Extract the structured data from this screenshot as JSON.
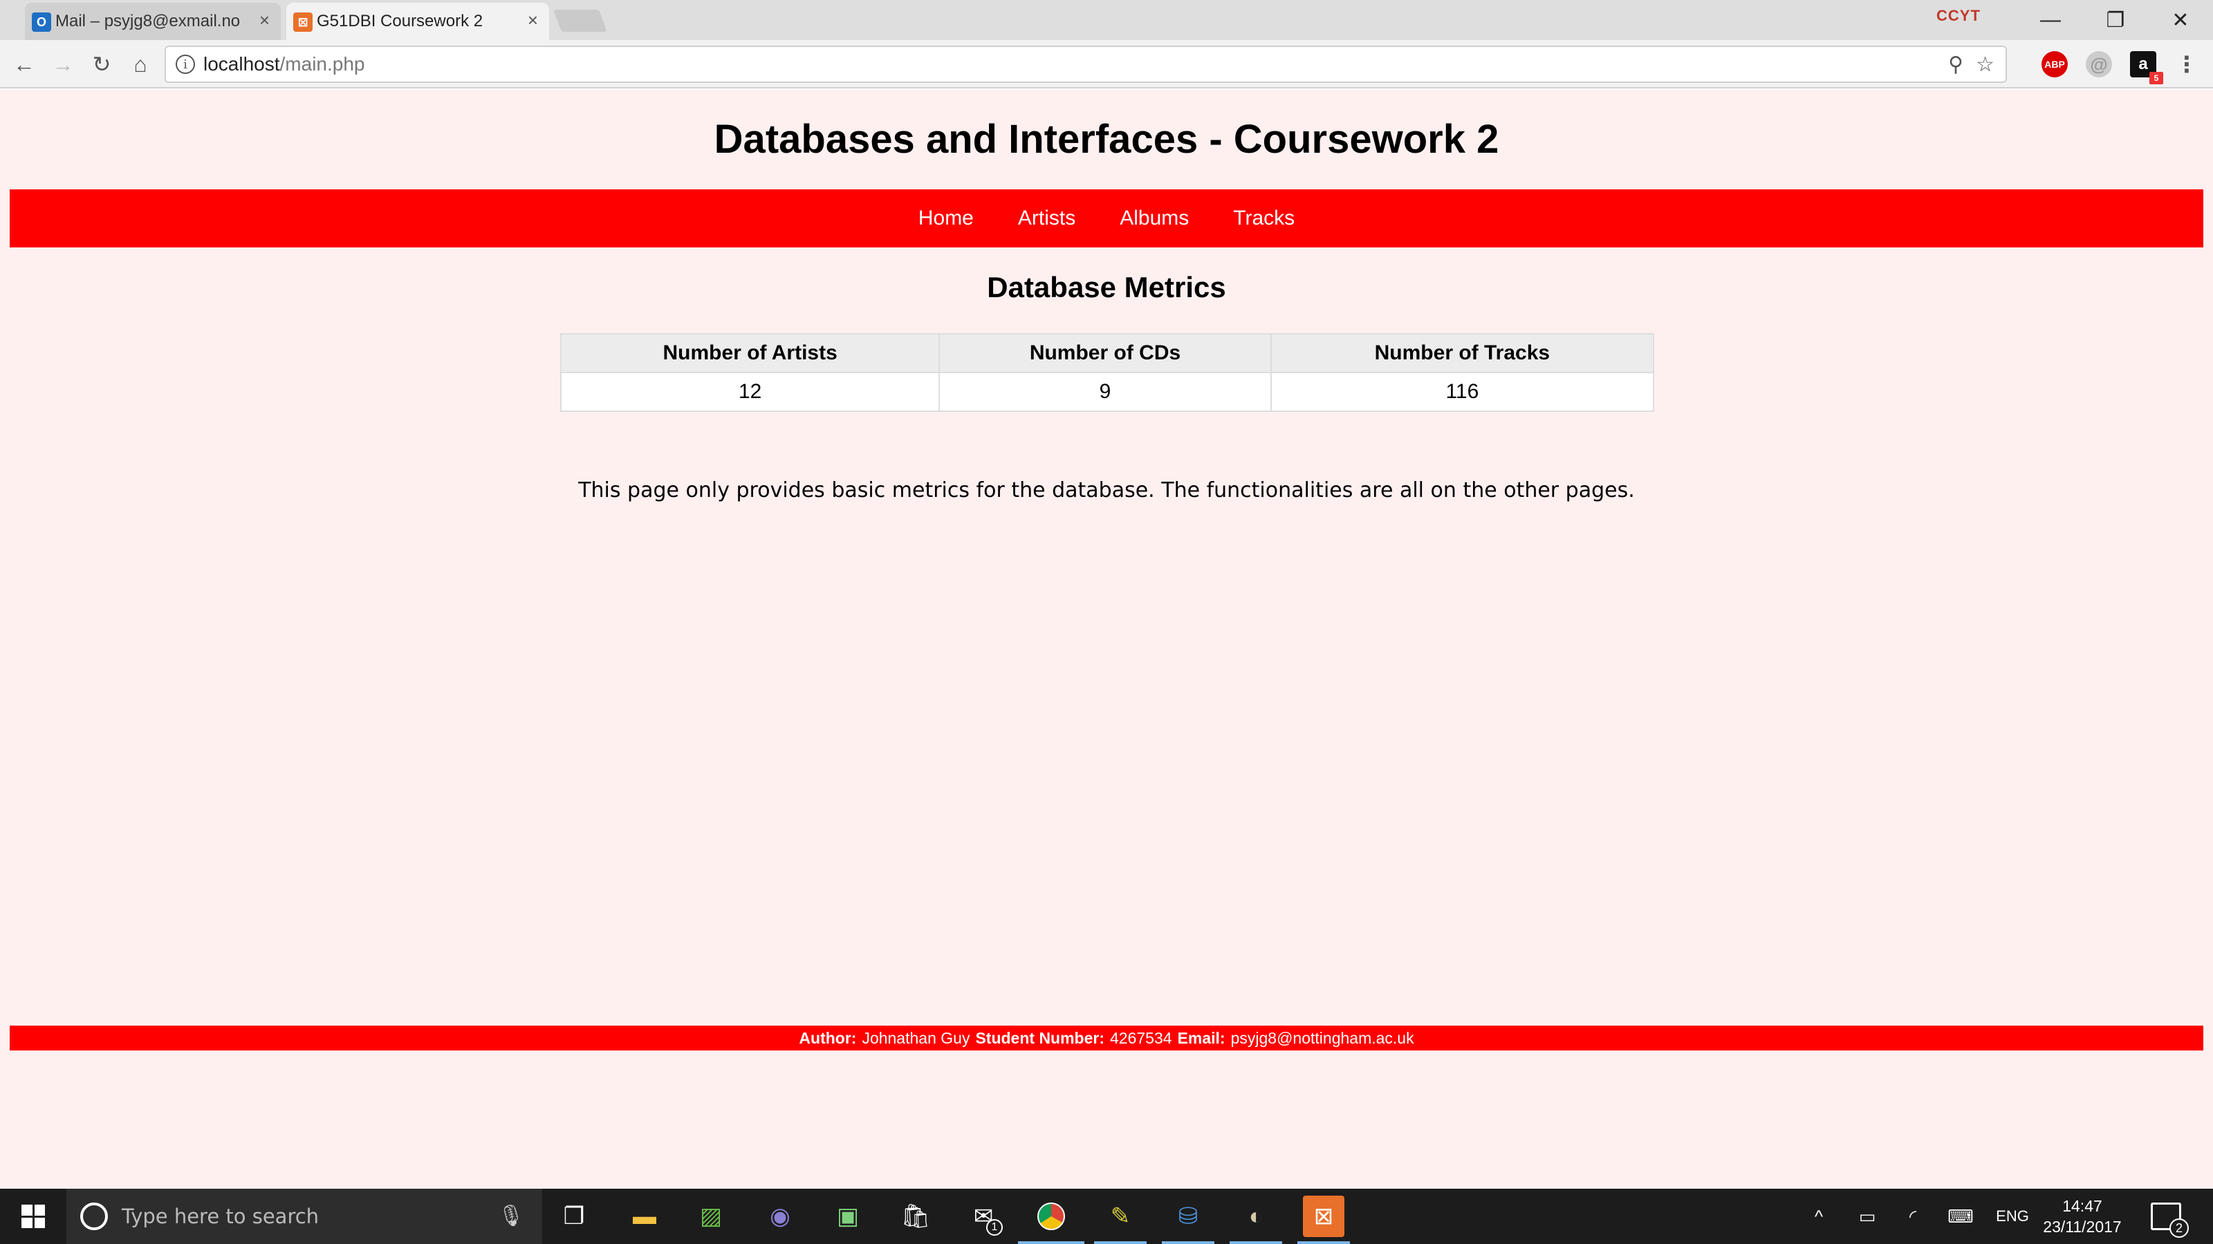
{
  "browser": {
    "tabs": [
      {
        "title": "Mail – psyjg8@exmail.no",
        "favicon": "outlook-icon",
        "active": false
      },
      {
        "title": "G51DBI Coursework 2",
        "favicon": "xampp-icon",
        "active": true
      }
    ],
    "extension_label": "CCYT",
    "url_host": "localhost",
    "url_path": "/main.php",
    "abp_label": "ABP",
    "amazon_label": "a",
    "amazon_badge": "5"
  },
  "page": {
    "title": "Databases and Interfaces - Coursework 2",
    "nav": [
      "Home",
      "Artists",
      "Albums",
      "Tracks"
    ],
    "metrics_heading": "Database Metrics",
    "table": {
      "headers": [
        "Number of Artists",
        "Number of CDs",
        "Number of Tracks"
      ],
      "values": [
        "12",
        "9",
        "116"
      ]
    },
    "info_text": "This page only provides basic metrics for the database. The functionalities are all on the other pages.",
    "footer": {
      "author_label": "Author:",
      "author": "Johnathan Guy",
      "student_number_label": "Student Number:",
      "student_number": "4267534",
      "email_label": "Email:",
      "email": "psyjg8@nottingham.ac.uk"
    }
  },
  "taskbar": {
    "search_placeholder": "Type here to search",
    "language": "ENG",
    "time": "14:47",
    "date": "23/11/2017",
    "mail_badge": "1",
    "notification_count": "2"
  },
  "colors": {
    "nav_bar": "#ff0000",
    "page_background": "#fff0f0",
    "table_header": "#ececec"
  }
}
